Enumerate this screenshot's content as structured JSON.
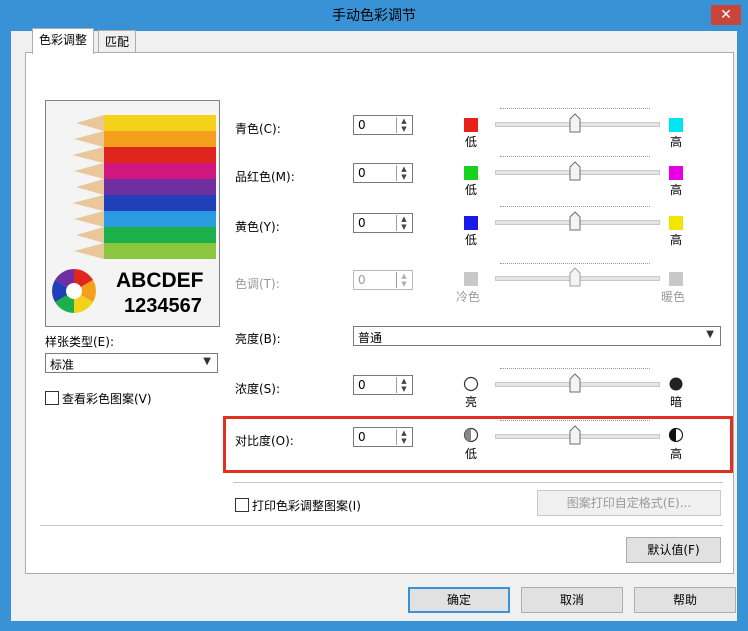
{
  "window": {
    "title": "手动色彩调节",
    "close_glyph": "✕"
  },
  "tabs": [
    {
      "label": "色彩调整",
      "active": true
    },
    {
      "label": "匹配",
      "active": false
    }
  ],
  "preview": {
    "line1": "ABCDEF",
    "line2": "1234567"
  },
  "paper_type": {
    "label": "样张类型(E):",
    "value": "标准"
  },
  "view_color_pattern": {
    "label": "查看彩色图案(V)",
    "checked": false
  },
  "sliders": [
    {
      "label": "青色(C):",
      "value": "0",
      "low_label": "低",
      "high_label": "高",
      "low_color": "#e8211a",
      "high_color": "#00e5f2",
      "enabled": true
    },
    {
      "label": "品红色(M):",
      "value": "0",
      "low_label": "低",
      "high_label": "高",
      "low_color": "#19d21f",
      "high_color": "#e600e6",
      "enabled": true
    },
    {
      "label": "黄色(Y):",
      "value": "0",
      "low_label": "低",
      "high_label": "高",
      "low_color": "#1a1ae6",
      "high_color": "#f2e600",
      "enabled": true
    },
    {
      "label": "色调(T):",
      "value": "0",
      "low_label": "冷色",
      "high_label": "暖色",
      "low_color": "#c8c8c8",
      "high_color": "#c8c8c8",
      "enabled": false
    }
  ],
  "brightness": {
    "label": "亮度(B):",
    "value": "普通"
  },
  "density": {
    "label": "浓度(S):",
    "value": "0",
    "low_label": "亮",
    "high_label": "暗"
  },
  "contrast": {
    "label": "对比度(O):",
    "value": "0",
    "low_label": "低",
    "high_label": "高"
  },
  "print_pattern": {
    "label": "打印色彩调整图案(I)",
    "checked": false
  },
  "pattern_button": "图案打印自定格式(E)...",
  "defaults_button": "默认值(F)",
  "ok_button": "确定",
  "cancel_button": "取消",
  "help_button": "帮助",
  "accent_color": "#3a92d6",
  "highlight_color": "#e0301e"
}
